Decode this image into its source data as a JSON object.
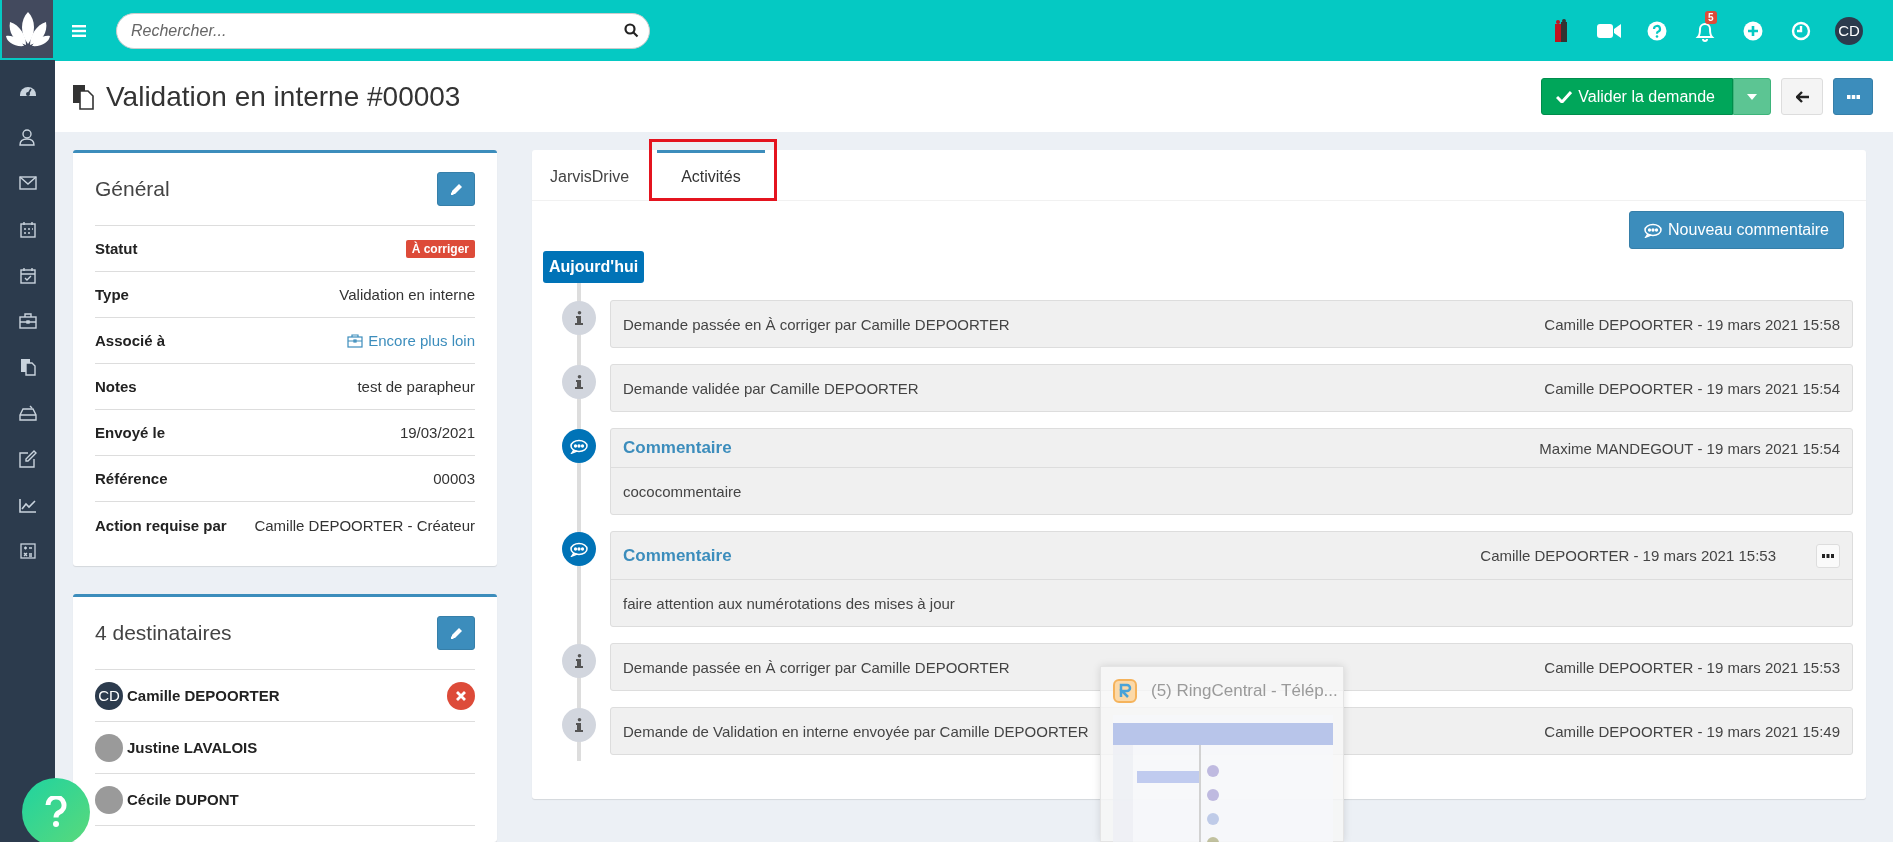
{
  "topbar": {
    "search": {
      "placeholder": "Rechercher..."
    },
    "notifications": {
      "count": "5"
    },
    "avatar": {
      "initials": "CD"
    }
  },
  "page": {
    "title": "Validation en interne #00003",
    "primary_action": "Valider la demande"
  },
  "general": {
    "title": "Général",
    "fields": [
      {
        "label": "Statut",
        "kind": "badge",
        "value": "À corriger"
      },
      {
        "label": "Type",
        "kind": "text",
        "value": "Validation en interne"
      },
      {
        "label": "Associé à",
        "kind": "link",
        "value": "Encore plus loin"
      },
      {
        "label": "Notes",
        "kind": "text",
        "value": "test de parapheur"
      },
      {
        "label": "Envoyé le",
        "kind": "text",
        "value": "19/03/2021"
      },
      {
        "label": "Référence",
        "kind": "text",
        "value": "00003"
      },
      {
        "label": "Action requise par",
        "kind": "text",
        "value": "Camille DEPOORTER - Créateur"
      }
    ]
  },
  "recipients": {
    "title": "4 destinataires",
    "items": [
      {
        "name": "Camille DEPOORTER",
        "kind": "initials",
        "initials": "CD",
        "removable": true
      },
      {
        "name": "Justine LAVALOIS",
        "kind": "photo",
        "removable": false
      },
      {
        "name": "Cécile DUPONT",
        "kind": "photo",
        "removable": false
      }
    ]
  },
  "tabs": [
    {
      "label": "JarvisDrive",
      "selected": false
    },
    {
      "label": "Activités",
      "selected": true
    }
  ],
  "new_comment_button": "Nouveau commentaire",
  "timeline": {
    "day": "Aujourd'hui",
    "entries": [
      {
        "kind": "info",
        "text": "Demande passée en À corriger par Camille DEPOORTER",
        "meta": "Camille DEPOORTER - 19 mars 2021 15:58"
      },
      {
        "kind": "info",
        "text": "Demande validée par Camille DEPOORTER",
        "meta": "Camille DEPOORTER - 19 mars 2021 15:54"
      },
      {
        "kind": "comment",
        "title": "Commentaire",
        "meta": "Maxime MANDEGOUT - 19 mars 2021 15:54",
        "text": "cococommentaire",
        "menu": false
      },
      {
        "kind": "comment",
        "title": "Commentaire",
        "meta": "Camille DEPOORTER - 19 mars 2021 15:53",
        "text": "faire attention aux numérotations des mises à jour",
        "menu": true
      },
      {
        "kind": "info",
        "text": "Demande passée en À corriger par Camille DEPOORTER",
        "meta": "Camille DEPOORTER - 19 mars 2021 15:53"
      },
      {
        "kind": "info",
        "text": "Demande de Validation en interne envoyée par Camille DEPOORTER",
        "meta": "Camille DEPOORTER - 19 mars 2021 15:49"
      }
    ]
  },
  "taskbar_preview": {
    "title": "(5) RingCentral - Télép..."
  }
}
